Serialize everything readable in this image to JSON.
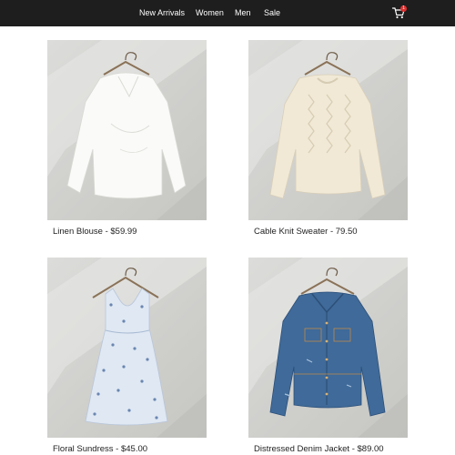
{
  "nav": {
    "items": [
      {
        "label": "New Arrivals"
      },
      {
        "label": "Women"
      },
      {
        "label": "Men"
      },
      {
        "label": "Sale"
      }
    ],
    "cart": {
      "icon": "cart-icon",
      "badge": "1"
    }
  },
  "products": [
    {
      "caption": "Linen Blouse - $59.99",
      "image": "white-blouse-on-hanger"
    },
    {
      "caption": "Cable Knit Sweater - 79.50",
      "image": "cream-cable-knit-sweater-on-hanger"
    },
    {
      "caption": "Floral Sundress - $45.00",
      "image": "blue-floral-sundress-on-hanger"
    },
    {
      "caption": "Distressed Denim Jacket - $89.00",
      "image": "denim-jacket-on-hanger"
    }
  ],
  "colors": {
    "topbar": "#1e1e1e",
    "badge": "#e03131"
  }
}
